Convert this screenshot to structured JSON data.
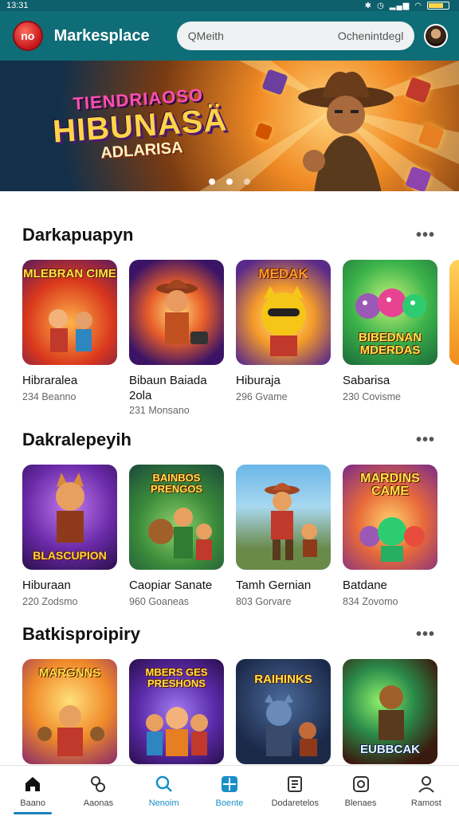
{
  "status": {
    "time": "13:31"
  },
  "header": {
    "title": "Markesplace",
    "search_left": "QMeith",
    "search_right": "Ochenintdegl",
    "logo_text": "no"
  },
  "banner": {
    "line1": "TIENDRIAOSO",
    "line2": "HIBUNASÄ",
    "line3": "ADLARISA",
    "slides": 3,
    "active_slide": 1
  },
  "sections": [
    {
      "title": "Darkapuapyn",
      "more": "•••",
      "items": [
        {
          "name": "Hibraralea",
          "sub": "234 Beanno",
          "art": "MLEBRAN CIME"
        },
        {
          "name": "Bibaun Baiada 2ola",
          "sub": "231 Monsano",
          "sub0": ""
        },
        {
          "name": "Hiburaja",
          "sub": "296 Gvame",
          "art": "MEDAK"
        },
        {
          "name": "Sabarisa",
          "sub": "230 Covisme",
          "art": "BIBEDNAN MDERDAS"
        }
      ]
    },
    {
      "title": "Dakralepeyih",
      "more": "•••",
      "items": [
        {
          "name": "Hiburaan",
          "sub": "220 Zodsmo",
          "art": "BLASCUPION"
        },
        {
          "name": "Caopiar Sanate",
          "sub": "960 Goaneas",
          "art": "BAINBOS PRENGOS"
        },
        {
          "name": "Tamh Gernian",
          "sub": "803 Gorvare",
          "art": ""
        },
        {
          "name": "Batdane",
          "sub": "834 Zovomo",
          "art": "MARDINS CAME"
        }
      ]
    },
    {
      "title": "Batkisproipiry",
      "more": "•••",
      "items": [
        {
          "name": "",
          "sub": "",
          "art": "MARGNNS"
        },
        {
          "name": "",
          "sub": "",
          "art": "MBERS GES PRESHONS"
        },
        {
          "name": "",
          "sub": "",
          "art": "RAIHINKS"
        },
        {
          "name": "",
          "sub": "",
          "art": "EUBBCAK"
        }
      ]
    }
  ],
  "nav": [
    {
      "label": "Baano",
      "icon": "home-icon"
    },
    {
      "label": "Aaonas",
      "icon": "category-icon"
    },
    {
      "label": "Nenoim",
      "icon": "search-icon"
    },
    {
      "label": "Boente",
      "icon": "grid-icon"
    },
    {
      "label": "Dodaretelos",
      "icon": "list-icon"
    },
    {
      "label": "Blenaes",
      "icon": "controller-icon"
    },
    {
      "label": "Ramost",
      "icon": "profile-icon"
    }
  ],
  "colors": {
    "header": "#0f6d78",
    "accent": "#1a8ec9"
  }
}
